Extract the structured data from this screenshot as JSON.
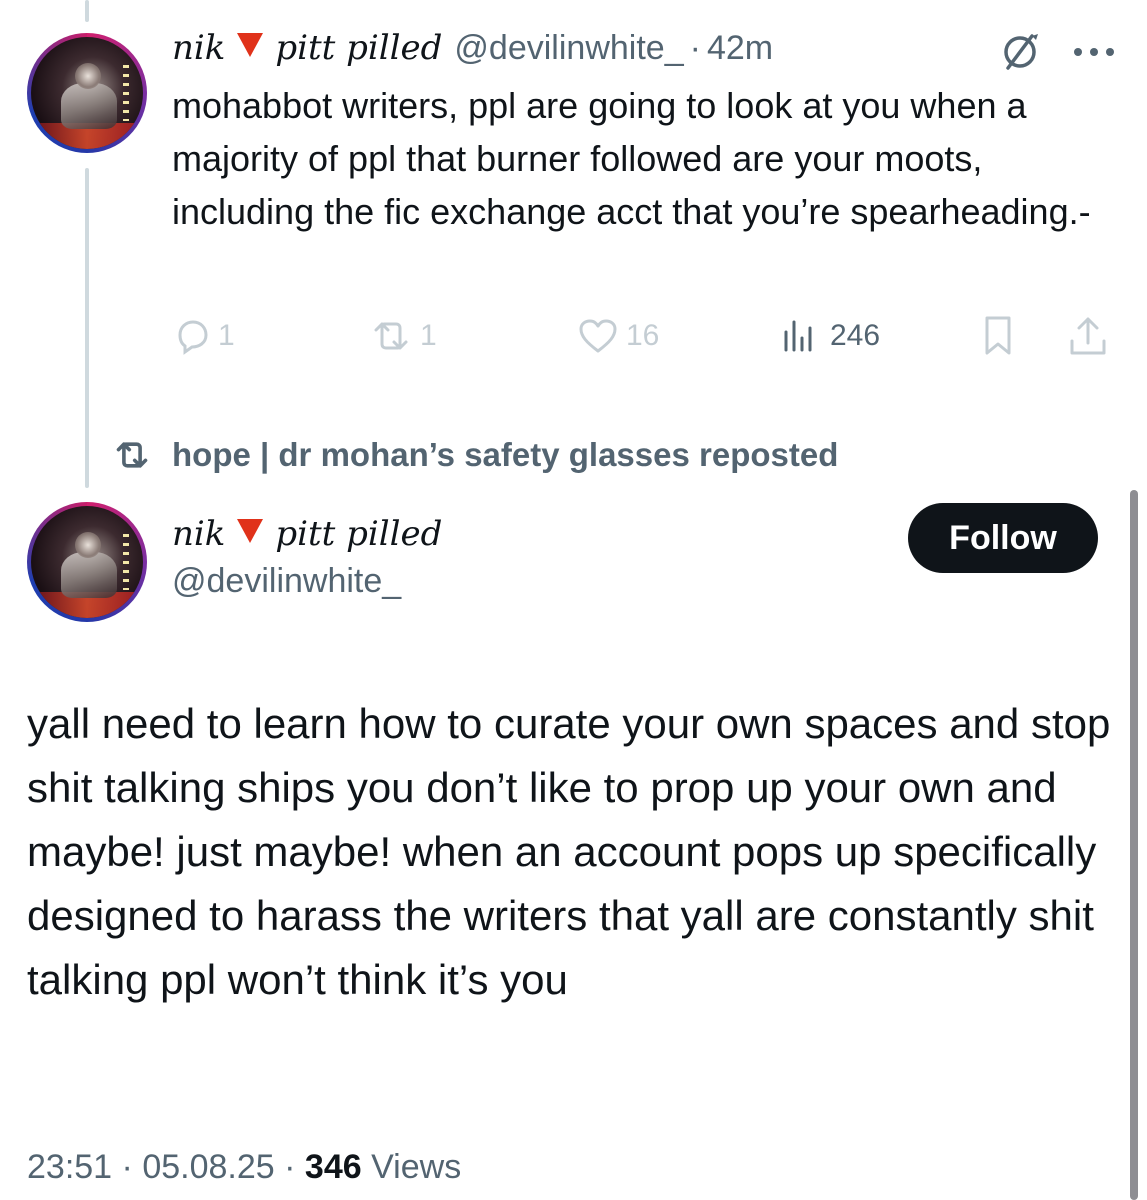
{
  "thread": {
    "parent": {
      "display_name": "nik",
      "display_name_suffix": "pitt pilled",
      "flag_icon": "red-triangle-down",
      "handle": "@devilinwhite_",
      "separator": "·",
      "time": "42m",
      "text": "mohabbot writers, ppl are going to look at you when a majority of ppl that burner followed are your moots, including the fic exchange acct that you’re spearheading.-",
      "actions": {
        "replies": "1",
        "reposts": "1",
        "likes": "16",
        "views": "246"
      },
      "icons": [
        "grok-icon",
        "more-icon",
        "reply-icon",
        "repost-icon",
        "like-icon",
        "views-icon",
        "bookmark-icon",
        "share-icon"
      ]
    },
    "repost_banner": {
      "icon": "repost-icon",
      "text": "hope | dr mohan’s safety glasses reposted"
    },
    "main": {
      "display_name": "nik",
      "display_name_suffix": "pitt pilled",
      "handle": "@devilinwhite_",
      "follow_label": "Follow",
      "text": "yall need to learn how to curate your own spaces and stop shit talking ships you don’t like to prop up your own and maybe! just maybe! when an account pops up specifically designed to harass the writers that yall are constantly shit talking ppl won’t think it’s you",
      "time": "23:51",
      "date": "05.08.25",
      "separator": "·",
      "views_count": "346",
      "views_label": "Views"
    }
  },
  "colors": {
    "text_primary": "#0f1419",
    "text_secondary": "#536471",
    "action_faded": "#c4cdd3",
    "flag_red": "#e0321a",
    "follow_bg": "#0f1419",
    "thread_line": "#cfd9de"
  }
}
